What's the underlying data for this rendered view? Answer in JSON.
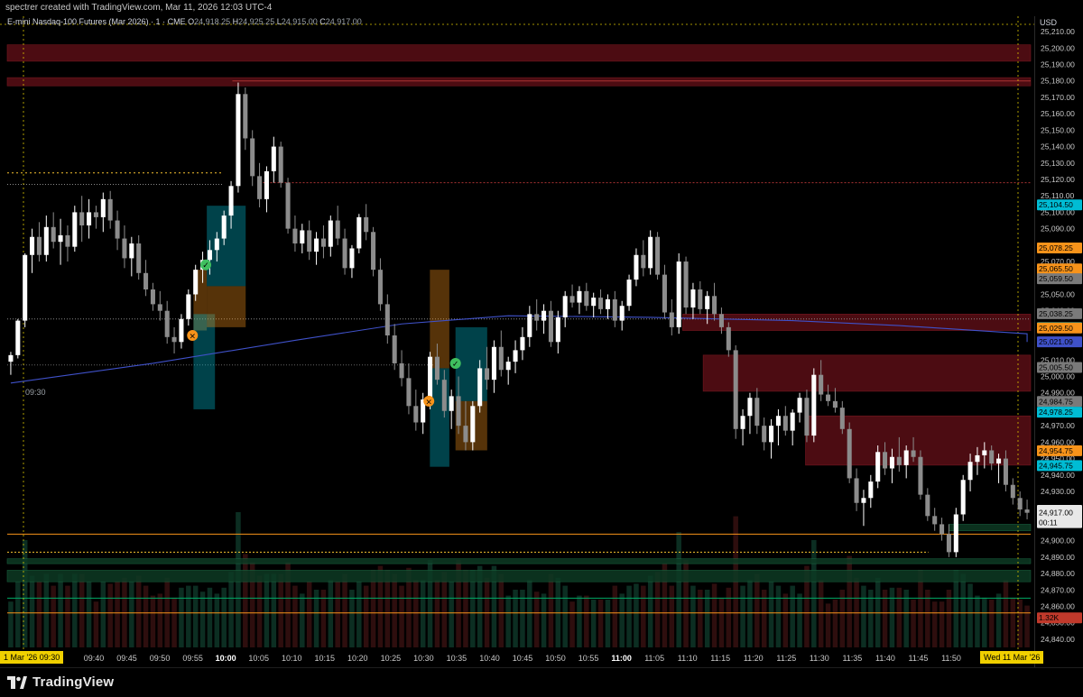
{
  "header": {
    "caption": "spectrer created with TradingView.com, Mar 11, 2026 12:03 UTC-4",
    "symbol": "E-mini Nasdaq-100 Futures (Mar 2026) · 1 · CME",
    "ohlc": [
      {
        "k": "O",
        "v": "24,918.25"
      },
      {
        "k": "H",
        "v": "24,925.25"
      },
      {
        "k": "L",
        "v": "24,915.00"
      },
      {
        "k": "C",
        "v": "24,917.00"
      }
    ]
  },
  "axis_currency": "USD",
  "session_label": "09:30",
  "badges": {
    "left": "1 Mar '26  09:30",
    "right": "Wed 11 Mar '26"
  },
  "brand": "TradingView",
  "colors": {
    "bg": "#000000",
    "candle_up": "#ffffff",
    "candle_down": "#8c8c8c",
    "vwap": "#3f51c9",
    "supply_zone": "#5a0f16",
    "demand_zone": "#0d3a24",
    "orange": "#f7931a",
    "cyan": "#00bcd4",
    "grey_tag": "#7a7a7a"
  },
  "chart_data": {
    "type": "candlestick",
    "title": "E-mini Nasdaq-100 Futures (Mar 2026) · 1 · CME",
    "ylim": [
      24835,
      25215
    ],
    "yticks": [
      25210,
      25200,
      25190,
      25180,
      25170,
      25160,
      25150,
      25140,
      25130,
      25120,
      25110,
      25100,
      25090,
      25080,
      25070,
      25060,
      25050,
      25040,
      25030,
      25020,
      25010,
      25000,
      24990,
      24980,
      24970,
      24960,
      24950,
      24940,
      24930,
      24920,
      24910,
      24900,
      24890,
      24880,
      24870,
      24860,
      24850,
      24840
    ],
    "xticks": [
      "09:40",
      "09:45",
      "09:50",
      "09:55",
      "10:00",
      "10:05",
      "10:10",
      "10:15",
      "10:20",
      "10:25",
      "10:30",
      "10:35",
      "10:40",
      "10:45",
      "10:50",
      "10:55",
      "11:00",
      "11:05",
      "11:10",
      "11:15",
      "11:20",
      "11:25",
      "11:30",
      "11:35",
      "11:40",
      "11:45",
      "11:50"
    ],
    "price_tags": [
      {
        "value": "25,104.50",
        "price": 25104.5,
        "color": "#00bcd4"
      },
      {
        "value": "25,078.25",
        "price": 25078.25,
        "color": "#f7931a"
      },
      {
        "value": "25,065.50",
        "price": 25065.5,
        "color": "#f7931a"
      },
      {
        "value": "25,059.50",
        "price": 25059.5,
        "color": "#7a7a7a"
      },
      {
        "value": "25,038.25",
        "price": 25038.25,
        "color": "#7a7a7a"
      },
      {
        "value": "25,029.75",
        "price": 25029.75,
        "color": "#00bcd4"
      },
      {
        "value": "25,029.50",
        "price": 25029.5,
        "color": "#f7931a"
      },
      {
        "value": "25,021.09",
        "price": 25021.09,
        "color": "#3f51c9"
      },
      {
        "value": "25,005.50",
        "price": 25005.5,
        "color": "#7a7a7a"
      },
      {
        "value": "24,984.75",
        "price": 24984.75,
        "color": "#7a7a7a"
      },
      {
        "value": "24,978.25",
        "price": 24978.25,
        "color": "#00bcd4"
      },
      {
        "value": "24,954.75",
        "price": 24954.75,
        "color": "#f7931a"
      },
      {
        "value": "24,945.75",
        "price": 24945.75,
        "color": "#00bcd4"
      },
      {
        "value": "24,918.50",
        "price": 24918.5,
        "color": "#ffffff"
      },
      {
        "value": "24,917.00",
        "price": 24917.0,
        "color": "#ffffff"
      },
      {
        "value": "00:11",
        "price": 24911.0,
        "color": "#ffffff"
      },
      {
        "value": "1.32K",
        "price": 24853.0,
        "color": "#c0392b"
      }
    ],
    "candles": [
      [
        25009,
        25015,
        25001,
        25013
      ],
      [
        25013,
        25035,
        25011,
        25034
      ],
      [
        25034,
        25075,
        25030,
        25074
      ],
      [
        25074,
        25090,
        25063,
        25085
      ],
      [
        25085,
        25094,
        25070,
        25074
      ],
      [
        25074,
        25098,
        25070,
        25091
      ],
      [
        25091,
        25100,
        25078,
        25082
      ],
      [
        25082,
        25096,
        25068,
        25086
      ],
      [
        25086,
        25092,
        25070,
        25079
      ],
      [
        25079,
        25104,
        25076,
        25100
      ],
      [
        25100,
        25110,
        25082,
        25092
      ],
      [
        25092,
        25108,
        25084,
        25100
      ],
      [
        25100,
        25104,
        25090,
        25097
      ],
      [
        25097,
        25112,
        25088,
        25108
      ],
      [
        25108,
        25113,
        25090,
        25095
      ],
      [
        25095,
        25101,
        25077,
        25084
      ],
      [
        25084,
        25092,
        25066,
        25072
      ],
      [
        25072,
        25085,
        25061,
        25081
      ],
      [
        25081,
        25086,
        25059,
        25063
      ],
      [
        25063,
        25071,
        25049,
        25053
      ],
      [
        25053,
        25057,
        25040,
        25044
      ],
      [
        25044,
        25052,
        25034,
        25040
      ],
      [
        25040,
        25046,
        25020,
        25024
      ],
      [
        25024,
        25030,
        25014,
        25021
      ],
      [
        25021,
        25038,
        25017,
        25035
      ],
      [
        25035,
        25053,
        25031,
        25050
      ],
      [
        25050,
        25068,
        25046,
        25065
      ],
      [
        25065,
        25076,
        25057,
        25071
      ],
      [
        25071,
        25083,
        25062,
        25077
      ],
      [
        25077,
        25088,
        25070,
        25084
      ],
      [
        25084,
        25101,
        25080,
        25098
      ],
      [
        25098,
        25119,
        25090,
        25116
      ],
      [
        25116,
        25179,
        25112,
        25172
      ],
      [
        25172,
        25176,
        25138,
        25145
      ],
      [
        25145,
        25150,
        25116,
        25122
      ],
      [
        25122,
        25130,
        25103,
        25108
      ],
      [
        25108,
        25128,
        25100,
        25125
      ],
      [
        25125,
        25146,
        25118,
        25140
      ],
      [
        25140,
        25143,
        25115,
        25118
      ],
      [
        25118,
        25121,
        25087,
        25090
      ],
      [
        25090,
        25098,
        25076,
        25081
      ],
      [
        25081,
        25093,
        25075,
        25089
      ],
      [
        25089,
        25095,
        25071,
        25076
      ],
      [
        25076,
        25088,
        25068,
        25084
      ],
      [
        25084,
        25092,
        25072,
        25079
      ],
      [
        25079,
        25098,
        25073,
        25095
      ],
      [
        25095,
        25104,
        25080,
        25084
      ],
      [
        25084,
        25090,
        25062,
        25066
      ],
      [
        25066,
        25080,
        25060,
        25078
      ],
      [
        25078,
        25099,
        25075,
        25097
      ],
      [
        25097,
        25105,
        25083,
        25088
      ],
      [
        25088,
        25091,
        25061,
        25065
      ],
      [
        25065,
        25072,
        25040,
        25044
      ],
      [
        25044,
        25050,
        25020,
        25025
      ],
      [
        25025,
        25032,
        25004,
        25008
      ],
      [
        25008,
        25016,
        24994,
        24999
      ],
      [
        24999,
        25008,
        24977,
        24982
      ],
      [
        24982,
        24992,
        24967,
        24972
      ],
      [
        24972,
        24990,
        24965,
        24986
      ],
      [
        24986,
        25015,
        24980,
        25012
      ],
      [
        25012,
        25020,
        24995,
        24998
      ],
      [
        24998,
        25004,
        24975,
        24979
      ],
      [
        24979,
        24992,
        24968,
        24988
      ],
      [
        24988,
        25000,
        24965,
        24970
      ],
      [
        24970,
        24985,
        24955,
        24960
      ],
      [
        24960,
        24985,
        24955,
        24982
      ],
      [
        24982,
        25010,
        24978,
        25005
      ],
      [
        25005,
        25018,
        24992,
        24998
      ],
      [
        24998,
        25022,
        24990,
        25018
      ],
      [
        25018,
        25028,
        25000,
        25004
      ],
      [
        25004,
        25012,
        24995,
        25009
      ],
      [
        25009,
        25022,
        25002,
        25016
      ],
      [
        25016,
        25030,
        25010,
        25024
      ],
      [
        25024,
        25043,
        25018,
        25038
      ],
      [
        25038,
        25047,
        25028,
        25034
      ],
      [
        25034,
        25044,
        25026,
        25040
      ],
      [
        25040,
        25046,
        25018,
        25021
      ],
      [
        25021,
        25040,
        25014,
        25036
      ],
      [
        25036,
        25052,
        25030,
        25049
      ],
      [
        25049,
        25056,
        25042,
        25045
      ],
      [
        25045,
        25055,
        25038,
        25052
      ],
      [
        25052,
        25057,
        25040,
        25043
      ],
      [
        25043,
        25051,
        25036,
        25048
      ],
      [
        25048,
        25053,
        25038,
        25041
      ],
      [
        25041,
        25050,
        25035,
        25047
      ],
      [
        25047,
        25052,
        25030,
        25034
      ],
      [
        25034,
        25046,
        25028,
        25043
      ],
      [
        25043,
        25062,
        25040,
        25059
      ],
      [
        25059,
        25078,
        25055,
        25074
      ],
      [
        25074,
        25083,
        25061,
        25066
      ],
      [
        25066,
        25089,
        25062,
        25085
      ],
      [
        25085,
        25088,
        25059,
        25062
      ],
      [
        25062,
        25068,
        25035,
        25039
      ],
      [
        25039,
        25047,
        25025,
        25030
      ],
      [
        25030,
        25075,
        25026,
        25070
      ],
      [
        25070,
        25073,
        25038,
        25042
      ],
      [
        25042,
        25057,
        25035,
        25053
      ],
      [
        25053,
        25058,
        25038,
        25041
      ],
      [
        25041,
        25052,
        25032,
        25049
      ],
      [
        25049,
        25057,
        25034,
        25038
      ],
      [
        25038,
        25042,
        25026,
        25030
      ],
      [
        25030,
        25033,
        25012,
        25016
      ],
      [
        25016,
        25019,
        24962,
        24968
      ],
      [
        24968,
        24980,
        24958,
        24976
      ],
      [
        24976,
        24990,
        24965,
        24987
      ],
      [
        24987,
        24993,
        24965,
        24970
      ],
      [
        24970,
        24975,
        24955,
        24960
      ],
      [
        24960,
        24974,
        24950,
        24970
      ],
      [
        24970,
        24980,
        24958,
        24976
      ],
      [
        24976,
        24982,
        24964,
        24967
      ],
      [
        24967,
        24980,
        24958,
        24978
      ],
      [
        24978,
        24990,
        24972,
        24987
      ],
      [
        24987,
        24992,
        24960,
        24964
      ],
      [
        24964,
        25005,
        24960,
        25001
      ],
      [
        25001,
        25010,
        24985,
        24989
      ],
      [
        24989,
        24995,
        24982,
        24985
      ],
      [
        24985,
        24993,
        24978,
        24981
      ],
      [
        24981,
        24985,
        24965,
        24968
      ],
      [
        24968,
        24972,
        24935,
        24938
      ],
      [
        24938,
        24944,
        24918,
        24923
      ],
      [
        24923,
        24931,
        24909,
        24926
      ],
      [
        24926,
        24940,
        24920,
        24936
      ],
      [
        24936,
        24958,
        24932,
        24954
      ],
      [
        24954,
        24960,
        24940,
        24944
      ],
      [
        24944,
        24956,
        24935,
        24951
      ],
      [
        24951,
        24963,
        24942,
        24946
      ],
      [
        24946,
        24958,
        24938,
        24955
      ],
      [
        24955,
        24963,
        24948,
        24951
      ],
      [
        24951,
        24955,
        24925,
        24928
      ],
      [
        24928,
        24932,
        24912,
        24915
      ],
      [
        24915,
        24920,
        24906,
        24910
      ],
      [
        24910,
        24914,
        24900,
        24904
      ],
      [
        24904,
        24910,
        24890,
        24893
      ],
      [
        24893,
        24920,
        24890,
        24916
      ],
      [
        24916,
        24940,
        24912,
        24937
      ],
      [
        24937,
        24953,
        24930,
        24948
      ],
      [
        24948,
        24957,
        24940,
        24952
      ],
      [
        24952,
        24960,
        24944,
        24955
      ],
      [
        24955,
        24958,
        24943,
        24947
      ],
      [
        24947,
        24953,
        24935,
        24950
      ],
      [
        24950,
        24955,
        24930,
        24934
      ],
      [
        24934,
        24938,
        24922,
        24926
      ],
      [
        24926,
        24930,
        24915,
        24919
      ],
      [
        24919,
        24925,
        24913,
        24917
      ]
    ],
    "vwap": [
      [
        0,
        24996
      ],
      [
        20,
        25008
      ],
      [
        40,
        25022
      ],
      [
        55,
        25032
      ],
      [
        70,
        25037
      ],
      [
        90,
        25036
      ],
      [
        110,
        25034
      ],
      [
        125,
        25031
      ],
      [
        145,
        25026
      ],
      [
        155,
        25021
      ]
    ],
    "zones": [
      {
        "kind": "supply",
        "p1": 25202,
        "p2": 25192,
        "x0": 0,
        "x1": 1.0
      },
      {
        "kind": "supply",
        "p1": 25182,
        "p2": 25177,
        "x0": 0,
        "x1": 1.0
      },
      {
        "kind": "supply",
        "p1": 25038,
        "p2": 25028,
        "x0": 0.66,
        "x1": 1.0
      },
      {
        "kind": "supply",
        "p1": 25013,
        "p2": 24991,
        "x0": 0.68,
        "x1": 1.0
      },
      {
        "kind": "supply",
        "p1": 24976,
        "p2": 24946,
        "x0": 0.78,
        "x1": 1.0
      },
      {
        "kind": "demand",
        "p1": 24889,
        "p2": 24886,
        "x0": 0,
        "x1": 1.0
      },
      {
        "kind": "demand",
        "p1": 24882,
        "p2": 24875,
        "x0": 0,
        "x1": 1.0
      },
      {
        "kind": "demand",
        "p1": 24910,
        "p2": 24906,
        "x0": 0.92,
        "x1": 1.0
      }
    ],
    "hlines": [
      {
        "p": 25180,
        "color": "#a33",
        "dash": "",
        "x0": 0.22,
        "x1": 1.0
      },
      {
        "p": 25118,
        "color": "#a33",
        "dash": "2,2",
        "x0": 0.25,
        "x1": 1.0
      },
      {
        "p": 25124,
        "color": "#f7c431",
        "dash": "2,3",
        "x0": 0.0,
        "x1": 0.21
      },
      {
        "p": 25117,
        "color": "#888",
        "dash": "1,2",
        "x0": 0.0,
        "x1": 0.21
      },
      {
        "p": 25035,
        "color": "#888",
        "dash": "1,2",
        "x0": 0.0,
        "x1": 1.0
      },
      {
        "p": 25007,
        "color": "#666",
        "dash": "1,2",
        "x0": 0.0,
        "x1": 0.42
      },
      {
        "p": 24904,
        "color": "#f7931a",
        "dash": "",
        "x0": 0.0,
        "x1": 1.0
      },
      {
        "p": 24893,
        "color": "#f7c431",
        "dash": "2,2",
        "x0": 0.0,
        "x1": 0.9
      },
      {
        "p": 24865,
        "color": "#0a6",
        "dash": "",
        "x0": 0.0,
        "x1": 1.0
      },
      {
        "p": 24856,
        "color": "#f7931a",
        "dash": "",
        "x0": 0.0,
        "x1": 1.0
      }
    ],
    "trade_boxes": [
      {
        "x0": 0.182,
        "x1": 0.195,
        "p1": 25065,
        "p2": 25028,
        "color": "#f7931a"
      },
      {
        "x0": 0.182,
        "x1": 0.203,
        "p1": 25038,
        "p2": 24980,
        "color": "#00bcd4"
      },
      {
        "x0": 0.195,
        "x1": 0.233,
        "p1": 25104,
        "p2": 25055,
        "color": "#00bcd4"
      },
      {
        "x0": 0.195,
        "x1": 0.233,
        "p1": 25055,
        "p2": 25030,
        "color": "#f7931a"
      },
      {
        "x0": 0.413,
        "x1": 0.432,
        "p1": 25065,
        "p2": 25005,
        "color": "#f7931a"
      },
      {
        "x0": 0.413,
        "x1": 0.432,
        "p1": 25005,
        "p2": 24945,
        "color": "#00bcd4"
      },
      {
        "x0": 0.438,
        "x1": 0.469,
        "p1": 25030,
        "p2": 24985,
        "color": "#00bcd4"
      },
      {
        "x0": 0.438,
        "x1": 0.469,
        "p1": 24985,
        "p2": 24955,
        "color": "#f7931a"
      }
    ],
    "markers": [
      {
        "x": 0.181,
        "p": 25025,
        "type": "exit",
        "color": "#f7931a"
      },
      {
        "x": 0.194,
        "p": 25068,
        "type": "entry",
        "color": "#3fbf5f"
      },
      {
        "x": 0.412,
        "p": 24985,
        "type": "exit",
        "color": "#f7931a"
      },
      {
        "x": 0.438,
        "p": 25008,
        "type": "entry",
        "color": "#3fbf5f"
      }
    ],
    "volume": [],
    "legend": "top-left",
    "grid": false
  }
}
